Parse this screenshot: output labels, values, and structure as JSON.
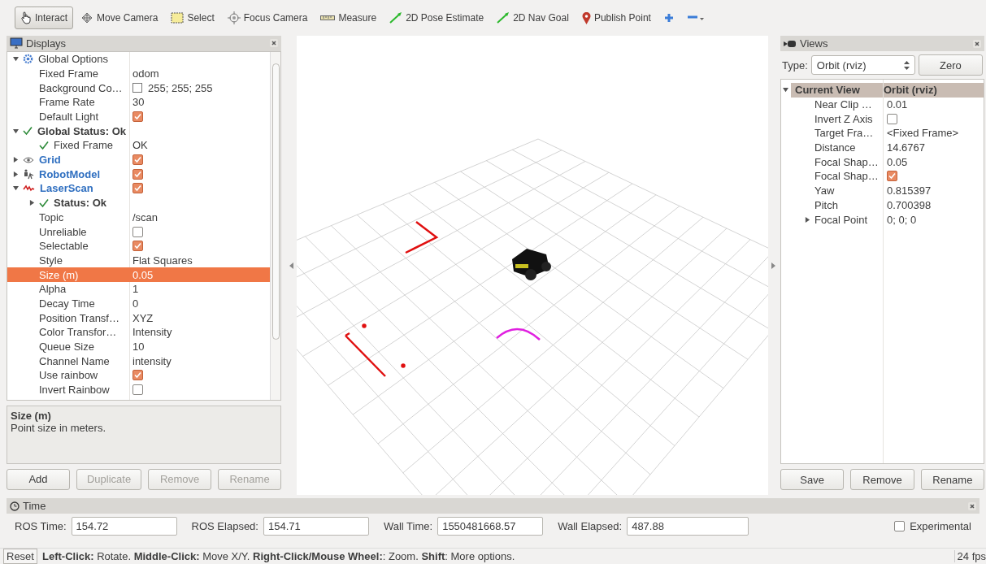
{
  "toolbar": {
    "tools": [
      {
        "label": "Interact",
        "selected": true
      },
      {
        "label": "Move Camera",
        "selected": false
      },
      {
        "label": "Select",
        "selected": false
      },
      {
        "label": "Focus Camera",
        "selected": false
      },
      {
        "label": "Measure",
        "selected": false
      },
      {
        "label": "2D Pose Estimate",
        "selected": false
      },
      {
        "label": "2D Nav Goal",
        "selected": false
      },
      {
        "label": "Publish Point",
        "selected": false
      }
    ]
  },
  "displays": {
    "title": "Displays",
    "items": [
      {
        "kind": "group",
        "label": "Global Options",
        "expanded": true,
        "selected": false,
        "children": [
          {
            "kind": "text",
            "label": "Fixed Frame",
            "value": "odom",
            "selected": false
          },
          {
            "kind": "color",
            "label": "Background Co…",
            "value": "255; 255; 255",
            "color": "#ffffff",
            "selected": false
          },
          {
            "kind": "text",
            "label": "Frame Rate",
            "value": "30",
            "selected": false
          },
          {
            "kind": "check",
            "label": "Default Light",
            "checked": true,
            "selected": false
          }
        ]
      },
      {
        "kind": "status",
        "label": "Global Status: Ok",
        "expanded": true,
        "selected": false,
        "children": [
          {
            "kind": "status",
            "label": "Fixed Frame",
            "value": "OK",
            "selected": false
          }
        ]
      },
      {
        "kind": "display",
        "label": "Grid",
        "expanded": false,
        "checked": true,
        "selected": false
      },
      {
        "kind": "display",
        "label": "RobotModel",
        "expanded": false,
        "checked": true,
        "selected": false
      },
      {
        "kind": "display",
        "label": "LaserScan",
        "expanded": true,
        "checked": true,
        "selected": false,
        "children": [
          {
            "kind": "status",
            "label": "Status: Ok",
            "expanded": false,
            "selected": false
          },
          {
            "kind": "text",
            "label": "Topic",
            "value": "/scan",
            "selected": false
          },
          {
            "kind": "check",
            "label": "Unreliable",
            "checked": false,
            "selected": false
          },
          {
            "kind": "check",
            "label": "Selectable",
            "checked": true,
            "selected": false
          },
          {
            "kind": "text",
            "label": "Style",
            "value": "Flat Squares",
            "selected": false
          },
          {
            "kind": "text",
            "label": "Size (m)",
            "value": "0.05",
            "selected": true
          },
          {
            "kind": "text",
            "label": "Alpha",
            "value": "1",
            "selected": false
          },
          {
            "kind": "text",
            "label": "Decay Time",
            "value": "0",
            "selected": false
          },
          {
            "kind": "text",
            "label": "Position Transf…",
            "value": "XYZ",
            "selected": false
          },
          {
            "kind": "text",
            "label": "Color Transfor…",
            "value": "Intensity",
            "selected": false
          },
          {
            "kind": "text",
            "label": "Queue Size",
            "value": "10",
            "selected": false
          },
          {
            "kind": "text",
            "label": "Channel Name",
            "value": "intensity",
            "selected": false
          },
          {
            "kind": "check",
            "label": "Use rainbow",
            "checked": true,
            "selected": false
          },
          {
            "kind": "check",
            "label": "Invert Rainbow",
            "checked": false,
            "selected": false
          }
        ]
      }
    ],
    "description": {
      "title": "Size (m)",
      "text": "Point size in meters."
    },
    "buttons": [
      {
        "label": "Add",
        "disabled": false
      },
      {
        "label": "Duplicate",
        "disabled": true
      },
      {
        "label": "Remove",
        "disabled": true
      },
      {
        "label": "Rename",
        "disabled": true
      }
    ]
  },
  "views": {
    "title": "Views",
    "type_label": "Type:",
    "type_value": "Orbit (rviz)",
    "zero_button": "Zero",
    "current": {
      "label": "Current View",
      "value": "Orbit (rviz)",
      "expanded": true
    },
    "rows": [
      {
        "kind": "text",
        "label": "Near Clip …",
        "value": "0.01"
      },
      {
        "kind": "check",
        "label": "Invert Z Axis",
        "checked": false
      },
      {
        "kind": "text",
        "label": "Target Fra…",
        "value": "<Fixed Frame>"
      },
      {
        "kind": "text",
        "label": "Distance",
        "value": "14.6767"
      },
      {
        "kind": "text",
        "label": "Focal Shap…",
        "value": "0.05"
      },
      {
        "kind": "check",
        "label": "Focal Shap…",
        "checked": true
      },
      {
        "kind": "text",
        "label": "Yaw",
        "value": "0.815397"
      },
      {
        "kind": "text",
        "label": "Pitch",
        "value": "0.700398"
      },
      {
        "kind": "text",
        "label": "Focal Point",
        "value": "0; 0; 0",
        "expanded": false
      }
    ],
    "buttons": [
      "Save",
      "Remove",
      "Rename"
    ]
  },
  "time": {
    "title": "Time",
    "fields": [
      {
        "label": "ROS Time:",
        "value": "154.72"
      },
      {
        "label": "ROS Elapsed:",
        "value": "154.71"
      },
      {
        "label": "Wall Time:",
        "value": "1550481668.57"
      },
      {
        "label": "Wall Elapsed:",
        "value": "487.88"
      }
    ],
    "experimental": {
      "label": "Experimental",
      "checked": false
    }
  },
  "status_bar": {
    "reset": "Reset",
    "message": "**Left-Click:** Rotate. **Middle-Click:** Move X/Y. **Right-Click/Mouse Wheel:**: Zoom. **Shift**: More options.",
    "fps": "24 fps"
  }
}
